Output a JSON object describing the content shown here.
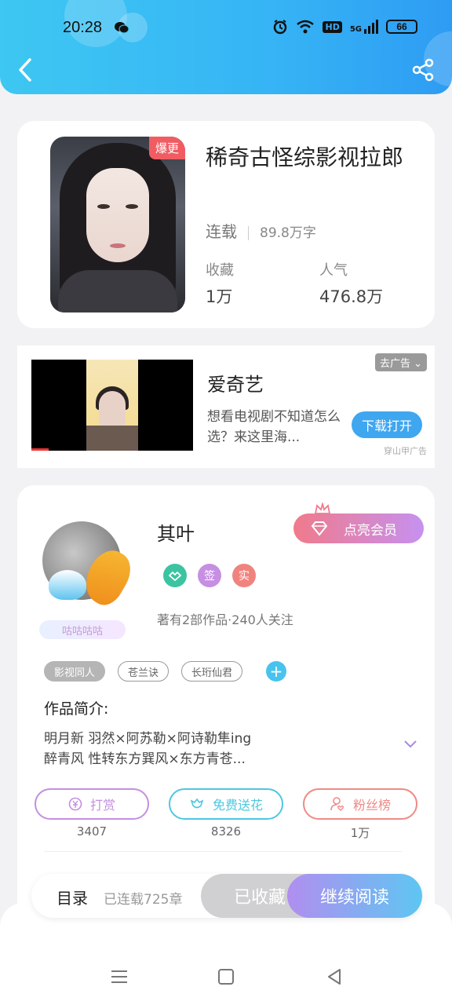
{
  "status_bar": {
    "time": "20:28",
    "hd": "HD",
    "network": "5G",
    "battery": "66"
  },
  "book": {
    "title": "稀奇古怪综影视拉郎",
    "hot_tag": "爆更",
    "status": "连载",
    "words": "89.8万字",
    "favorites_label": "收藏",
    "favorites_value": "1万",
    "popularity_label": "人气",
    "popularity_value": "476.8万"
  },
  "ad": {
    "title": "爱奇艺",
    "description": "想看电视剧不知道怎么选？来这里海...",
    "close_label": "去广告",
    "button_label": "下载打开",
    "source": "穿山甲广告"
  },
  "author": {
    "name": "其叶",
    "badge": "咕咕咕咕",
    "vip_label": "点亮会员",
    "badges": [
      "签",
      "实"
    ],
    "meta": "著有2部作品·240人关注",
    "tags": [
      "影视同人",
      "苍兰诀",
      "长珩仙君"
    ],
    "intro_title": "作品简介:",
    "intro_line1": "明月新  羽然×阿苏勒×阿诗勒隼ing",
    "intro_line2": "醉青风  性转东方巽风×东方青苍..."
  },
  "actions": [
    {
      "label": "打赏",
      "count": "3407",
      "color": "#c48fe0"
    },
    {
      "label": "免费送花",
      "count": "8326",
      "color": "#4fc7e0"
    },
    {
      "label": "粉丝榜",
      "count": "1万",
      "color": "#ef8a86"
    }
  ],
  "read_bar": {
    "catalog": "目录",
    "chapters": "已连载725章",
    "collected": "已收藏",
    "continue": "继续阅读"
  }
}
